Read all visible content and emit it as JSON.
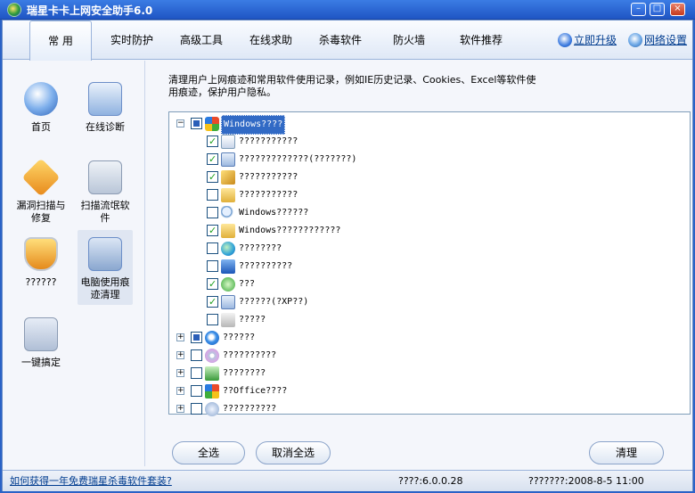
{
  "window": {
    "title": "瑞星卡卡上网安全助手6.0",
    "minimize": "–",
    "maximize": "□",
    "close": "×"
  },
  "menu": {
    "items": [
      "常 用",
      "实时防护",
      "高级工具",
      "在线求助",
      "杀毒软件",
      "防火墙",
      "软件推荐"
    ],
    "upgrade": "立即升级",
    "network": "网络设置"
  },
  "leftnav": {
    "items": [
      {
        "label": "首页",
        "icon": "home-icon"
      },
      {
        "label": "在线诊断",
        "icon": "diagnosis-icon"
      },
      {
        "label": "漏洞扫描与修复",
        "icon": "vulnerability-icon"
      },
      {
        "label": "扫描流氓软件",
        "icon": "scan-icon"
      },
      {
        "label": "??????",
        "icon": "shield-icon"
      },
      {
        "label": "电脑使用痕迹清理",
        "icon": "broom-icon"
      },
      {
        "label": "一键搞定",
        "icon": "one-click-icon"
      }
    ]
  },
  "content": {
    "description": "清理用户上网痕迹和常用软件使用记录，例如IE历史记录、Cookies、Excel等软件使用痕迹，保护用户隐私。",
    "tree": {
      "root": {
        "label": "Windows????",
        "expander": "−"
      },
      "children": [
        {
          "label": "???????????",
          "checked": true
        },
        {
          "label": "?????????????(???????)",
          "checked": true
        },
        {
          "label": "???????????",
          "checked": true
        },
        {
          "label": "???????????",
          "checked": false
        },
        {
          "label": "Windows??????",
          "checked": false
        },
        {
          "label": "Windows????????????",
          "checked": true
        },
        {
          "label": "????????",
          "checked": false
        },
        {
          "label": "??????????",
          "checked": false
        },
        {
          "label": "???",
          "checked": true
        },
        {
          "label": "??????(?XP??)",
          "checked": true
        },
        {
          "label": "?????",
          "checked": false
        }
      ],
      "groups": [
        {
          "label": "??????",
          "state": "partial",
          "expander": "+"
        },
        {
          "label": "??????????",
          "state": "unchecked",
          "expander": "+"
        },
        {
          "label": "????????",
          "state": "unchecked",
          "expander": "+"
        },
        {
          "label": "??Office????",
          "state": "unchecked",
          "expander": "+"
        },
        {
          "label": "??????????",
          "state": "unchecked",
          "expander": "+"
        }
      ]
    },
    "buttons": {
      "select_all": "全选",
      "deselect_all": "取消全选",
      "clean": "清理"
    }
  },
  "status": {
    "link": "如何获得一年免费瑞星杀毒软件套装?",
    "version": "????:6.0.0.28",
    "date": "???????:2008-8-5 11:00"
  }
}
